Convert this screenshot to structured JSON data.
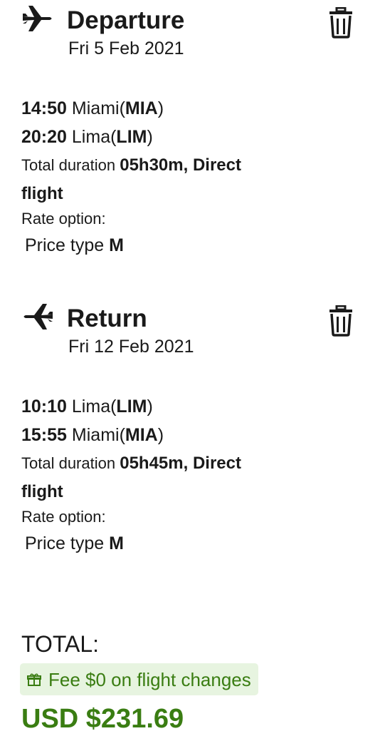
{
  "departure": {
    "title": "Departure",
    "date": "Fri 5 Feb 2021",
    "icon": "plane-icon",
    "delete_icon": "trash-icon",
    "segments": [
      {
        "time": "14:50",
        "city": "Miami(",
        "code": "MIA",
        "close": ")"
      },
      {
        "time": "20:20",
        "city": "Lima(",
        "code": "LIM",
        "close": ")"
      }
    ],
    "duration_label": "Total duration",
    "duration_value": "05h30m, Direct flight",
    "rate_label": "Rate option:",
    "price_type_label": "Price type",
    "price_type_value": "M"
  },
  "return": {
    "title": "Return",
    "date": "Fri 12 Feb 2021",
    "icon": "plane-icon",
    "delete_icon": "trash-icon",
    "segments": [
      {
        "time": "10:10",
        "city": "Lima(",
        "code": "LIM",
        "close": ")"
      },
      {
        "time": "15:55",
        "city": "Miami(",
        "code": "MIA",
        "close": ")"
      }
    ],
    "duration_label": "Total duration",
    "duration_value": "05h45m, Direct flight",
    "rate_label": "Rate option:",
    "price_type_label": "Price type",
    "price_type_value": "M"
  },
  "summary": {
    "total_label": "TOTAL:",
    "fee_text": "Fee $0 on flight changes",
    "fee_icon": "gift-icon",
    "total_amount": "USD $231.69"
  },
  "colors": {
    "accent_green": "#3a7d12",
    "badge_bg": "#e7f4e0",
    "text": "#1a1a1a"
  }
}
